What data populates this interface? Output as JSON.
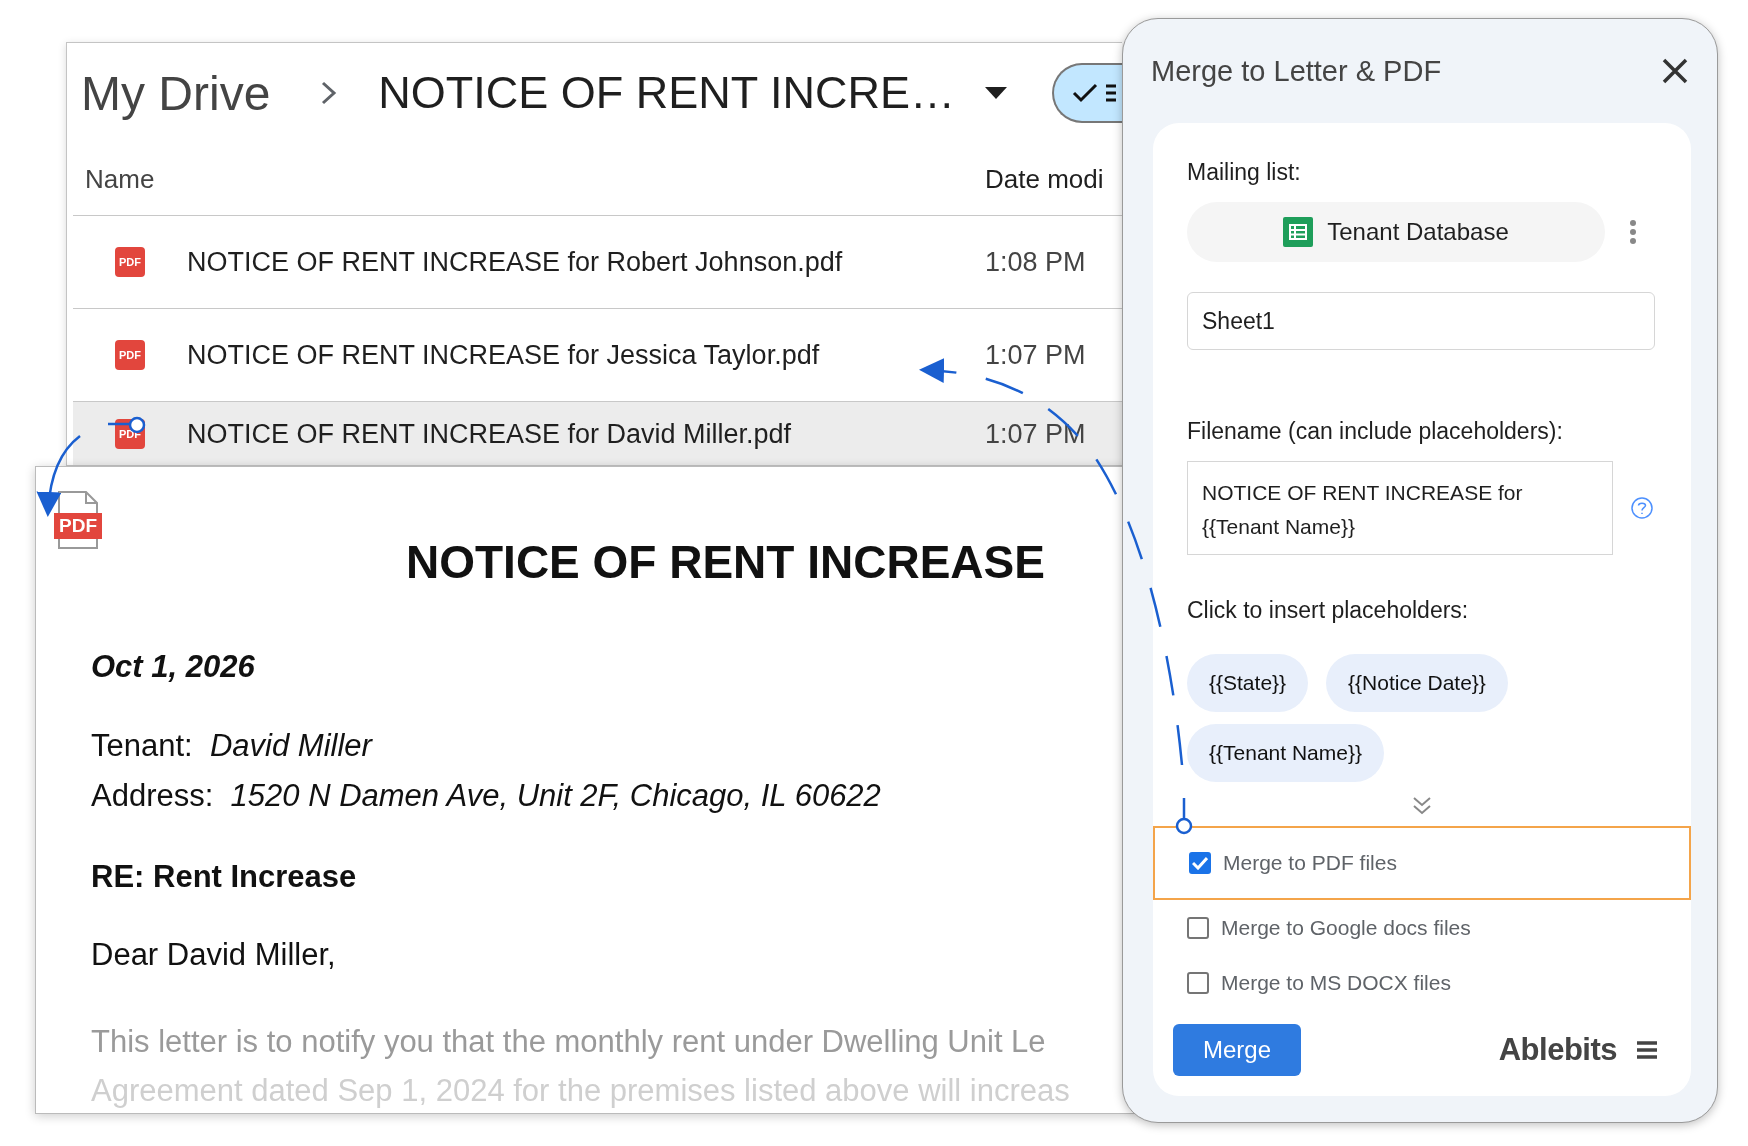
{
  "drive": {
    "breadcrumb": [
      "My Drive",
      "NOTICE OF RENT INCRE…"
    ],
    "view_toggle": {
      "selected": true
    },
    "columns": [
      "Name",
      "Date modi"
    ],
    "files": [
      {
        "badge": "PDF",
        "name": "NOTICE OF RENT INCREASE for Robert Johnson.pdf",
        "modified": "1:08 PM",
        "selected": false
      },
      {
        "badge": "PDF",
        "name": "NOTICE OF RENT INCREASE for Jessica Taylor.pdf",
        "modified": "1:07 PM",
        "selected": false
      },
      {
        "badge": "PDF",
        "name": "NOTICE OF RENT INCREASE for David Miller.pdf",
        "modified": "1:07 PM",
        "selected": true
      }
    ]
  },
  "document": {
    "badge": "PDF",
    "title": "NOTICE OF RENT INCREASE",
    "date": "Oct 1, 2026",
    "fields": [
      {
        "label": "Tenant:",
        "value": "David Miller"
      },
      {
        "label": "Address:",
        "value": "1520 N Damen Ave, Unit 2F, Chicago, IL 60622"
      }
    ],
    "subject": "RE: Rent Increase",
    "greeting": "Dear David Miller,",
    "body_lines": [
      "This letter is to notify you that the monthly rent under Dwelling Unit Le",
      "Agreement dated Sep 1, 2024 for the premises listed above will increas"
    ]
  },
  "panel": {
    "title": "Merge to Letter & PDF",
    "mailing_list_label": "Mailing list:",
    "mailing_list": "Tenant Database",
    "sheet": "Sheet1",
    "filename_label": "Filename (can include placeholders):",
    "filename": "NOTICE OF RENT INCREASE for {{Tenant Name}}",
    "placeholders_label": "Click to insert placeholders:",
    "placeholders": [
      "{{State}}",
      "{{Notice Date}}",
      "{{Tenant Name}}"
    ],
    "options": [
      {
        "label": "Merge to PDF files",
        "checked": true,
        "highlighted": true
      },
      {
        "label": "Merge to Google docs files",
        "checked": false,
        "highlighted": false
      },
      {
        "label": "Merge to MS DOCX files",
        "checked": false,
        "highlighted": false
      }
    ],
    "merge_button": "Merge",
    "brand": "Ablebits"
  }
}
